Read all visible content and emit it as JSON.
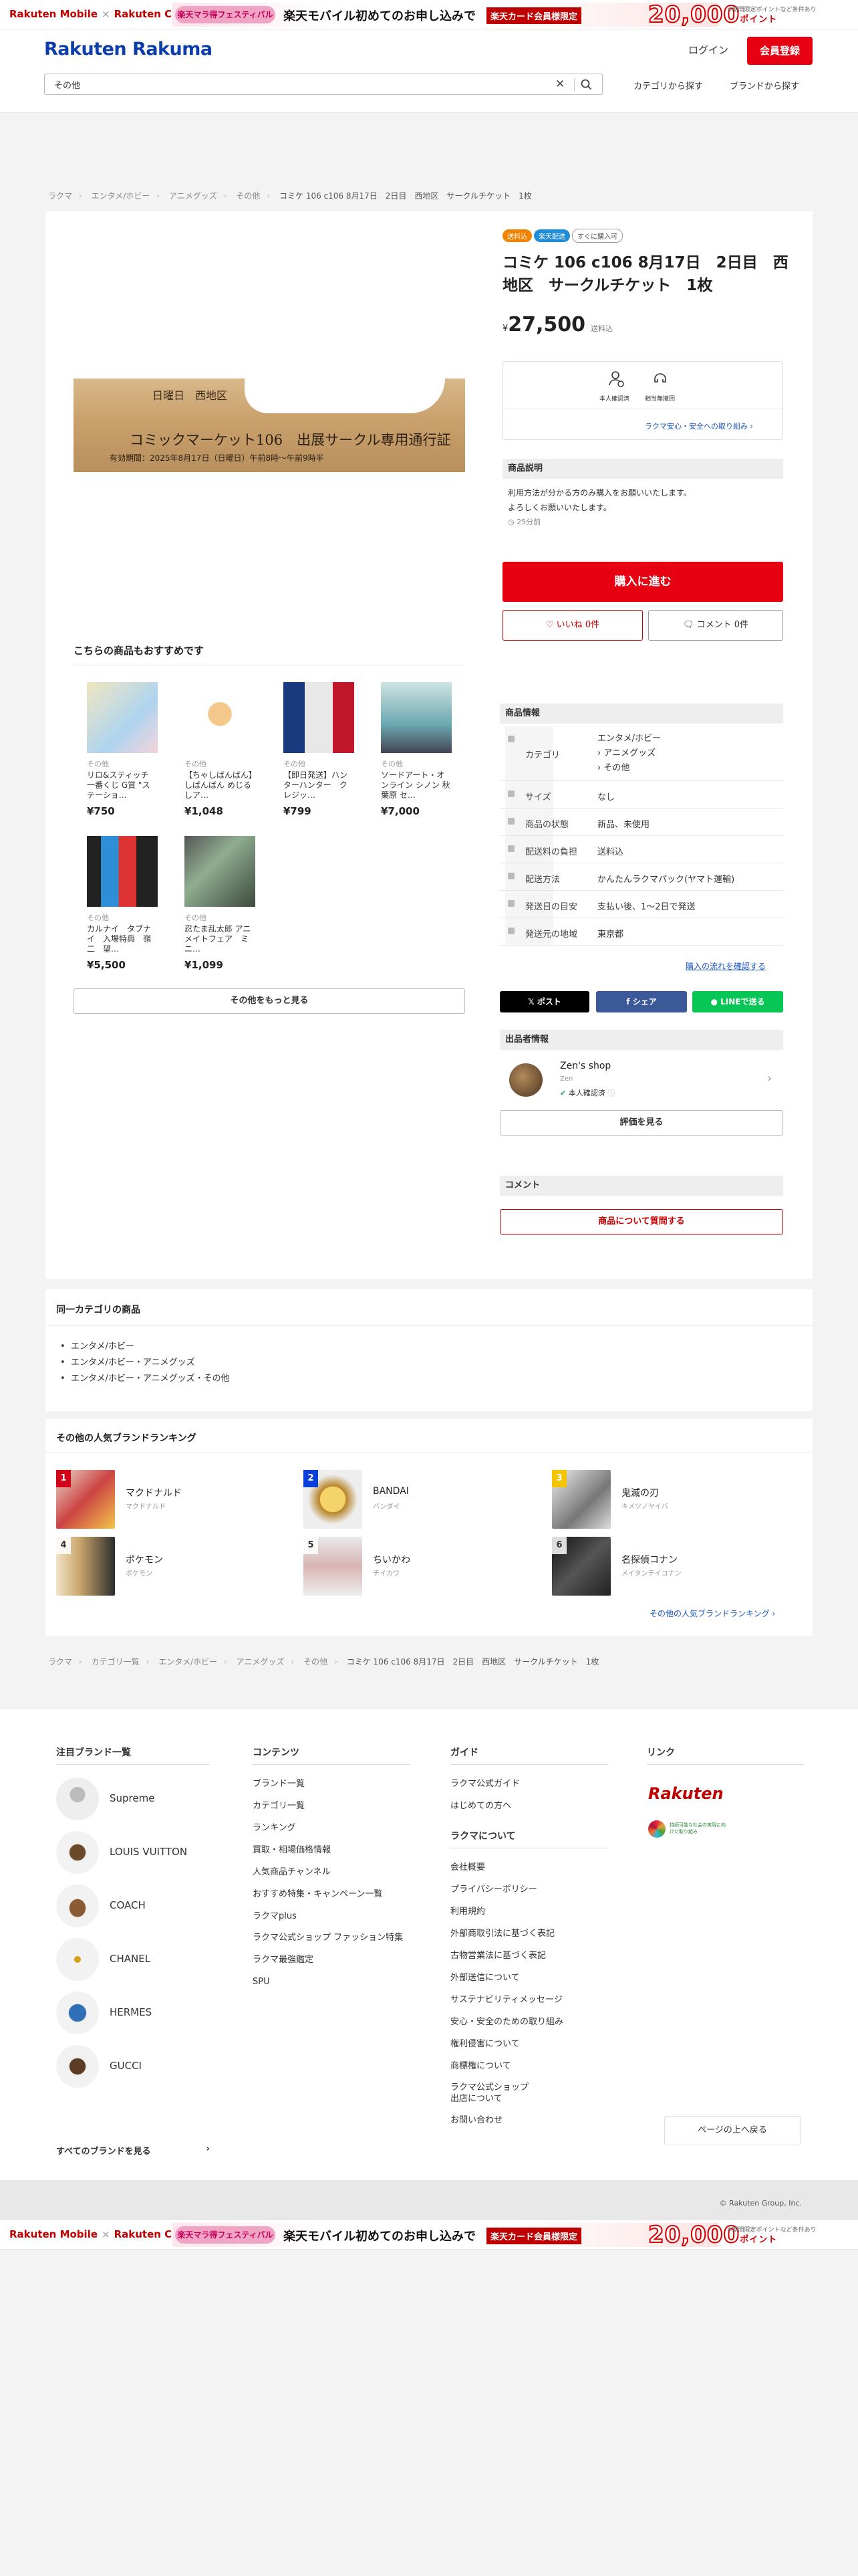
{
  "promo": {
    "left_logo": "Rakuten Mobile",
    "left_logo2": "Rakuten Card",
    "festival": "楽天マラ得フェスティバル",
    "message": "楽天モバイル初めてのお申し込みで",
    "card_tag": "楽天カード会員様限定",
    "points": "20,000",
    "points_unit": "ポイント",
    "note": "※期間限定ポイントなど条件あり"
  },
  "header": {
    "logo": "Rakuten Rakuma",
    "login": "ログイン",
    "signup": "会員登録",
    "search_value": "その他",
    "category_link": "カテゴリから探す",
    "brand_link": "ブランドから探す"
  },
  "breadcrumb": [
    "ラクマ",
    "エンタメ/ホビー",
    "アニメグッズ",
    "その他",
    "コミケ 106 c106 8月17日　2日目　西地区　サークルチケット　1枚"
  ],
  "product": {
    "image_line1": "日曜日　西地区",
    "image_line2": "コミックマーケット106　出展サークル専用通行証",
    "image_line3": "有効期間：2025年8月17日（日曜日）午前8時〜午前9時半",
    "badges": [
      "送料込",
      "楽天配送",
      "すぐに購入可"
    ],
    "title": "コミケ 106 c106 8月17日　2日目　西地区　サークルチケット　1枚",
    "currency": "¥",
    "price": "27,500",
    "shipping_note": "送料込",
    "assure1": "本人確認済",
    "assure2": "相当無撤回",
    "assure_link": "ラクマ安心・安全への取り組み",
    "desc_header": "商品説明",
    "desc": "利用方法が分かる方のみ購入をお願いいたします。\nよろしくお願いいたします。",
    "time_ago": "25分前",
    "buy": "購入に進む",
    "like": "いいね",
    "like_count": "0件",
    "comment": "コメント",
    "comment_count": "0件"
  },
  "recommend": {
    "title": "こちらの商品もおすすめです",
    "items": [
      {
        "cat": "その他",
        "title": "リロ&スティッチ 一番くじ G賞 \"ステーショ…",
        "price": "¥750"
      },
      {
        "cat": "その他",
        "title": "【ちゃしばんばん】しばんばん めじるしア…",
        "price": "¥1,048"
      },
      {
        "cat": "その他",
        "title": "【即日発送】ハンターハンター　クレジッ…",
        "price": "¥799"
      },
      {
        "cat": "その他",
        "title": "ソードアート・オンライン シノン 秋葉原 セ…",
        "price": "¥7,000"
      },
      {
        "cat": "その他",
        "title": "カルナイ　タブナイ　入場特典　嶺二　望…",
        "price": "¥5,500"
      },
      {
        "cat": "その他",
        "title": "忍たま乱太郎 アニメイトフェア　ミニ…",
        "price": "¥1,099"
      }
    ],
    "more": "その他をもっと見る"
  },
  "info": {
    "header": "商品情報",
    "rows": [
      {
        "label": "カテゴリ",
        "value": [
          "エンタメ/ホビー",
          "› アニメグッズ",
          "› その他"
        ]
      },
      {
        "label": "サイズ",
        "value": [
          "なし"
        ]
      },
      {
        "label": "商品の状態",
        "value": [
          "新品、未使用"
        ]
      },
      {
        "label": "配送料の負担",
        "value": [
          "送料込"
        ]
      },
      {
        "label": "配送方法",
        "value": [
          "かんたんラクマパック(ヤマト運輸)"
        ]
      },
      {
        "label": "発送日の目安",
        "value": [
          "支払い後、1〜2日で発送"
        ]
      },
      {
        "label": "発送元の地域",
        "value": [
          "東京都"
        ]
      }
    ],
    "flow_link": "購入の流れを確認する"
  },
  "share": {
    "x": "ポスト",
    "fb": "シェア",
    "line": "LINEで送る"
  },
  "seller": {
    "header": "出品者情報",
    "shop": "Zen's shop",
    "sub": "Zen",
    "verified": "本人確認済",
    "review": "評価を見る"
  },
  "comment_section": {
    "header": "コメント",
    "ask": "商品について質問する"
  },
  "same_category": {
    "title": "同一カテゴリの商品",
    "items": [
      "エンタメ/ホビー",
      "エンタメ/ホビー・アニメグッズ",
      "エンタメ/ホビー・アニメグッズ・その他"
    ]
  },
  "ranking": {
    "title": "その他の人気ブランドランキング",
    "items": [
      {
        "rank": "1",
        "name": "マクドナルド",
        "kana": "マクドナルド",
        "badge": "#d0021b"
      },
      {
        "rank": "2",
        "name": "BANDAI",
        "kana": "バンダイ",
        "badge": "#0a3fd8"
      },
      {
        "rank": "3",
        "name": "鬼滅の刃",
        "kana": "キメツノヤイバ",
        "badge": "#f5c400"
      },
      {
        "rank": "4",
        "name": "ポケモン",
        "kana": "ポケモン",
        "badge": ""
      },
      {
        "rank": "5",
        "name": "ちいかわ",
        "kana": "チイカワ",
        "badge": ""
      },
      {
        "rank": "6",
        "name": "名探偵コナン",
        "kana": "メイタンテイコナン",
        "badge": ""
      }
    ],
    "link": "その他の人気ブランドランキング"
  },
  "breadcrumb2": [
    "ラクマ",
    "カテゴリ一覧",
    "エンタメ/ホビー",
    "アニメグッズ",
    "その他",
    "コミケ 106 c106 8月17日　2日目　西地区　サークルチケット　1枚"
  ],
  "footer": {
    "brands_title": "注目ブランド一覧",
    "brands": [
      "Supreme",
      "LOUIS VUITTON",
      "COACH",
      "CHANEL",
      "HERMES",
      "GUCCI"
    ],
    "all_brands": "すべてのブランドを見る",
    "contents_title": "コンテンツ",
    "contents": [
      "ブランド一覧",
      "カテゴリ一覧",
      "ランキング",
      "買取・相場価格情報",
      "人気商品チャンネル",
      "おすすめ特集・キャンペーン一覧",
      "ラクマplus",
      "ラクマ公式ショップ ファッション特集",
      "ラクマ最強鑑定",
      "SPU"
    ],
    "guide_title": "ガイド",
    "guide": [
      "ラクマ公式ガイド",
      "はじめての方へ"
    ],
    "about_title": "ラクマについて",
    "about": [
      "会社概要",
      "プライバシーポリシー",
      "利用規約",
      "外部商取引法に基づく表記",
      "古物営業法に基づく表記",
      "外部送信について",
      "サステナビリティメッセージ",
      "安心・安全のための取り組み",
      "権利侵害について",
      "商標権について",
      "ラクマ公式ショップ\n出店について",
      "お問い合わせ"
    ],
    "link_title": "リンク",
    "rakuten": "Rakuten",
    "sdgs": "持続可能な社会の実現に向けた取り組み",
    "back_top": "ページの上へ戻る",
    "copyright": "© Rakuten Group, Inc."
  }
}
